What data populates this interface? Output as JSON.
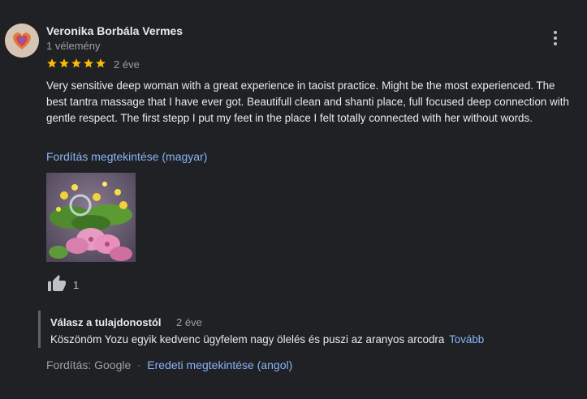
{
  "review": {
    "author_name": "Veronika Borbála Vermes",
    "review_count": "1 vélemény",
    "rating": 5,
    "rating_max": 5,
    "age": "2 éve",
    "text": "Very sensitive deep woman with a great experience in taoist practice. Might be the most experienced. The best tantra massage that I have ever got. Beautifull clean and shanti place, full focused deep connection with gentle respect. The first stepp I put my feet in the place I felt totally connected with her without words.",
    "translate_link": "Fordítás megtekintése (magyar)",
    "like_count": "1",
    "icons": {
      "avatar": "avatar-heart",
      "more": "more-vert-icon",
      "star": "star-icon",
      "like": "thumb-up-icon"
    }
  },
  "reply": {
    "title": "Válasz a tulajdonostól",
    "age": "2 éve",
    "text": "Köszönöm Yozu egyik kedvenc ügyfelem nagy ölelés és puszi az aranyos arcodra",
    "more_label": "Tovább"
  },
  "footer": {
    "translated_by": "Fordítás: Google",
    "separator": "·",
    "original_link": "Eredeti megtekintése (angol)"
  },
  "colors": {
    "background": "#202124",
    "star": "#fbbc04",
    "link": "#8ab4f8",
    "text": "#e8eaed",
    "muted": "#9aa0a6"
  }
}
